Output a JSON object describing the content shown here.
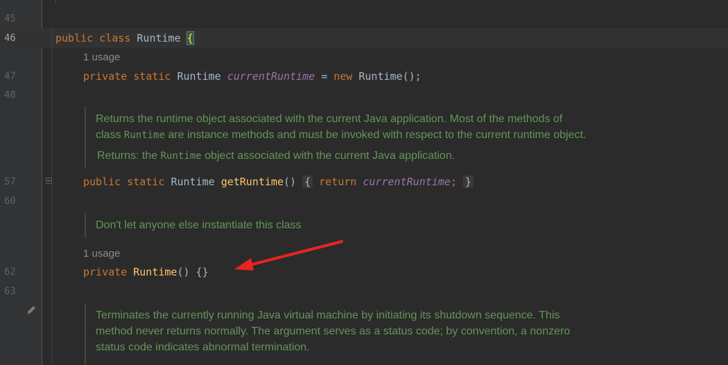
{
  "gutter": {
    "line_numbers": [
      "45",
      "46",
      "47",
      "48",
      "57",
      "60",
      "62",
      "63"
    ]
  },
  "code": {
    "line46": {
      "kw1": "public",
      "kw2": "class",
      "name": "Runtime",
      "brace": "{"
    },
    "usage1": "1 usage",
    "line47": {
      "kw1": "private",
      "kw2": "static",
      "type": "Runtime",
      "field": "currentRuntime",
      "op": "=",
      "kw3": "new",
      "ctor": "Runtime();"
    },
    "doc1": {
      "para_a": "Returns the runtime object associated with the current Java application. Most of the methods of",
      "para_b_pre": "class ",
      "para_b_code": "Runtime",
      "para_b_post": " are instance methods and must be invoked with respect to the current runtime object.",
      "returns_pre": "Returns: the ",
      "returns_code": "Runtime",
      "returns_post": " object associated with the current Java application."
    },
    "line57": {
      "kw1": "public",
      "kw2": "static",
      "type": "Runtime",
      "method": "getRuntime",
      "parens": "()",
      "open": "{",
      "kw3": "return",
      "field": "currentRuntime",
      "semi": ";",
      "close": "}"
    },
    "doc2": "Don't let anyone else instantiate this class",
    "usage2": "1 usage",
    "line62": {
      "kw1": "private",
      "ctor": "Runtime",
      "rest": "() {}"
    },
    "doc3": {
      "line_a": "Terminates the currently running Java virtual machine by initiating its shutdown sequence. This",
      "line_b": "method never returns normally. The argument serves as a status code; by convention, a nonzero",
      "line_c": "status code indicates abnormal termination."
    }
  },
  "colors": {
    "background": "#2b2b2b",
    "keyword": "#cc7832",
    "field": "#9876aa",
    "method": "#ffc66d",
    "doc": "#629755",
    "annotation_arrow": "#e8251f"
  }
}
